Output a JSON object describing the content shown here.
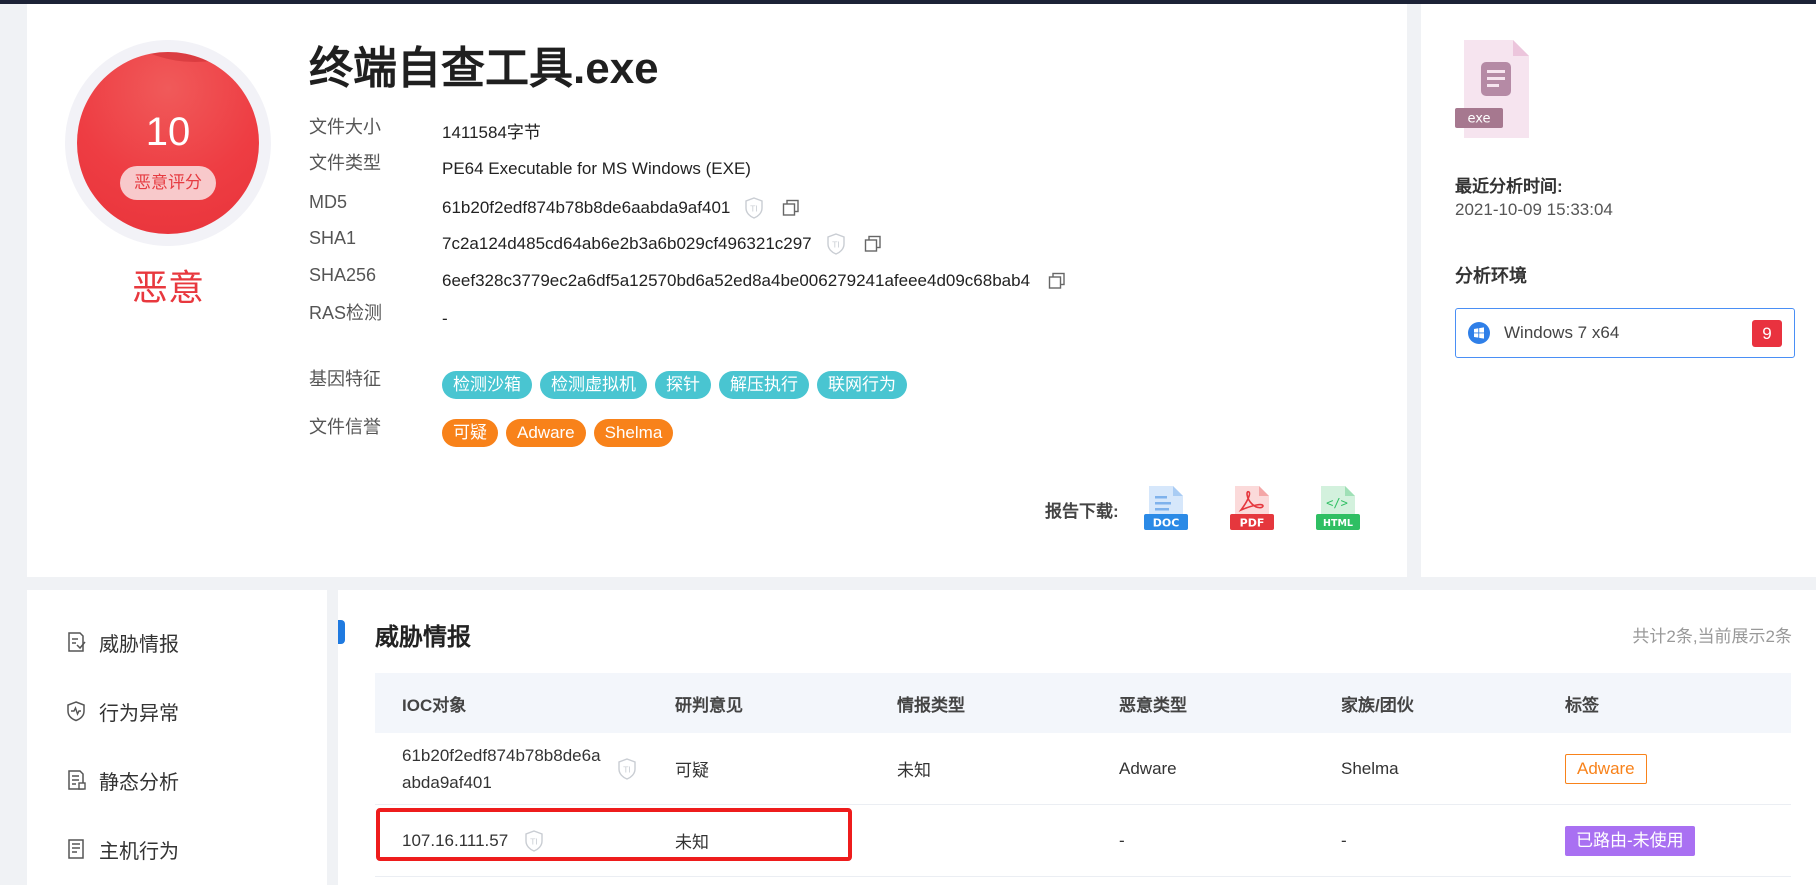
{
  "summary": {
    "score": "10",
    "score_label": "恶意评分",
    "verdict": "恶意",
    "file_name": "终端自查工具.exe",
    "fields": [
      {
        "label": "文件大小",
        "value": "1411584字节"
      },
      {
        "label": "文件类型",
        "value": "PE64 Executable for MS Windows (EXE)"
      },
      {
        "label": "MD5",
        "value": "61b20f2edf874b78b8de6aabda9af401"
      },
      {
        "label": "SHA1",
        "value": "7c2a124d485cd64ab6e2b3a6b029cf496321c297"
      },
      {
        "label": "SHA256",
        "value": "6eef328c3779ec2a6df5a12570bd6a52ed8a4be006279241afeee4d09c68bab4"
      },
      {
        "label": "RAS检测",
        "value": "-"
      },
      {
        "label": "基因特征",
        "value": ""
      },
      {
        "label": "文件信誉",
        "value": ""
      }
    ],
    "gene_tags": [
      "检测沙箱",
      "检测虚拟机",
      "探针",
      "解压执行",
      "联网行为"
    ],
    "reputation_tags": [
      "可疑",
      "Adware",
      "Shelma"
    ],
    "report_label": "报告下载:",
    "report_formats": [
      "DOC",
      "PDF",
      "HTML"
    ]
  },
  "env": {
    "file_ext": "exe",
    "recent_label": "最近分析时间:",
    "recent_time": "2021-10-09 15:33:04",
    "env_label": "分析环境",
    "env_name": "Windows 7 x64",
    "env_count": "9"
  },
  "nav": {
    "items": [
      {
        "label": "威胁情报",
        "icon": "threat-intel-icon"
      },
      {
        "label": "行为异常",
        "icon": "shield-icon"
      },
      {
        "label": "静态分析",
        "icon": "static-analysis-icon"
      },
      {
        "label": "主机行为",
        "icon": "host-behavior-icon"
      }
    ]
  },
  "intel": {
    "title": "威胁情报",
    "count_text": "共计2条,当前展示2条",
    "columns": [
      "IOC对象",
      "研判意见",
      "情报类型",
      "恶意类型",
      "家族/团伙",
      "标签"
    ],
    "rows": [
      {
        "ioc_line1": "61b20f2edf874b78b8de6a",
        "ioc_line2": "abda9af401",
        "opinion": "可疑",
        "intel_type": "未知",
        "malware_type": "Adware",
        "family": "Shelma",
        "tag": "Adware"
      },
      {
        "ioc_line1": "107.16.111.57",
        "ioc_line2": "",
        "opinion": "未知",
        "intel_type": "",
        "malware_type": "-",
        "family": "-",
        "tag": "已路由-未使用"
      }
    ]
  },
  "colors": {
    "malicious_red": "#e8383e",
    "tag_cyan": "#49c5d1",
    "tag_orange": "#f8821a",
    "tag_purple": "#a970f2",
    "accent_blue": "#1f7ae0",
    "highlight_red": "#ee1c1c"
  }
}
